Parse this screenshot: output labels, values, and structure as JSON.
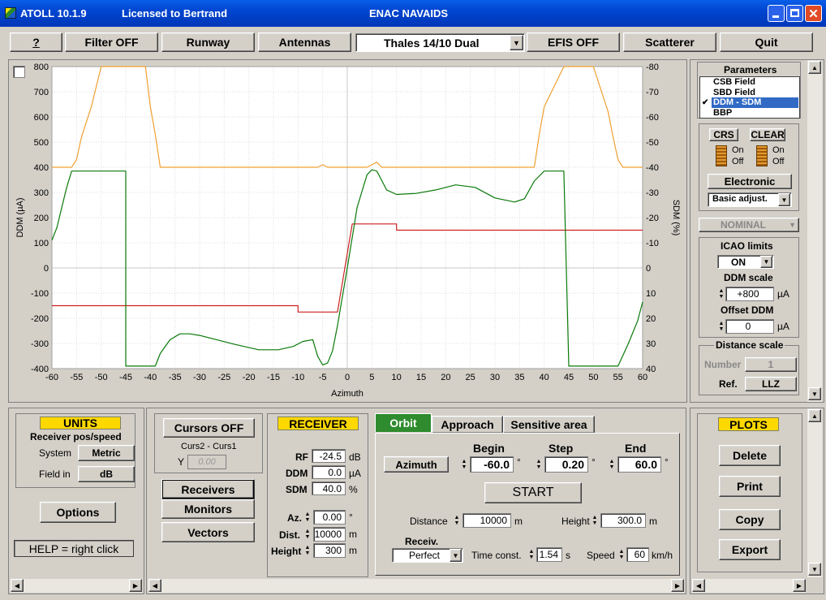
{
  "titlebar": {
    "app": "ATOLL 10.1.9",
    "license": "Licensed to Bertrand",
    "center": "ENAC NAVAIDS"
  },
  "toolbar": {
    "help": "?",
    "filter": "Filter OFF",
    "runway": "Runway",
    "antennas": "Antennas",
    "system": "Thales 14/10 Dual",
    "efis": "EFIS OFF",
    "scatterer": "Scatterer",
    "quit": "Quit"
  },
  "chart_data": {
    "type": "line",
    "xlabel": "Azimuth",
    "ylabel": "DDM (µA)",
    "y2label": "SDM (%)",
    "xlim": [
      -60,
      60
    ],
    "ylim": [
      -400,
      800
    ],
    "y2lim": [
      -40,
      -80
    ],
    "xticks": [
      "-60",
      "-55",
      "-50",
      "-45",
      "-40",
      "-35",
      "-30",
      "-25",
      "-20",
      "-15",
      "-10",
      "-5",
      "0",
      "5",
      "10",
      "15",
      "20",
      "25",
      "30",
      "35",
      "40",
      "45",
      "50",
      "55",
      "60"
    ],
    "yticks": [
      "800",
      "700",
      "600",
      "500",
      "400",
      "300",
      "200",
      "100",
      "0",
      "-100",
      "-200",
      "-300",
      "-400"
    ],
    "y2ticks": [
      "-80",
      "-70",
      "-60",
      "-50",
      "-40",
      "-30",
      "-20",
      "-10",
      "0",
      "10",
      "20",
      "30",
      "40"
    ],
    "colors": {
      "ddm": "#0a7a0a",
      "sdm": "#f0a030",
      "icao": "#cc2020",
      "ref": "#33d6d6"
    },
    "series": [
      {
        "name": "DDM - SDM",
        "x": [
          -60,
          -59,
          -58,
          -57,
          -56,
          -45,
          -45,
          -39,
          -38,
          -36,
          -34,
          -32,
          -30,
          -27,
          -23,
          -18,
          -14,
          -11,
          -9,
          -7,
          -6,
          -5,
          -4,
          -3,
          -2,
          0,
          2,
          4,
          5,
          6,
          8,
          10,
          14,
          18,
          22,
          26,
          30,
          34,
          36,
          38,
          40,
          44,
          45,
          55,
          57,
          59,
          60
        ],
        "y": [
          110,
          160,
          240,
          320,
          385,
          385,
          -390,
          -390,
          -340,
          -285,
          -262,
          -262,
          -268,
          -283,
          -303,
          -325,
          -325,
          -312,
          -292,
          -285,
          -352,
          -385,
          -378,
          -330,
          -230,
          0,
          240,
          370,
          390,
          385,
          310,
          292,
          296,
          310,
          330,
          320,
          278,
          262,
          275,
          345,
          385,
          385,
          -390,
          -390,
          -305,
          -210,
          -135
        ]
      },
      {
        "name": "SDM",
        "x": [
          -60,
          -57,
          -56,
          -55,
          -54,
          -52,
          -50,
          -45,
          -44,
          -44,
          -41,
          -40,
          -39,
          -38,
          -20,
          -10,
          -6,
          -5,
          -4,
          0,
          4,
          5,
          6,
          7,
          10,
          30,
          38,
          39,
          40,
          44,
          44,
          45,
          48,
          50,
          53,
          54,
          55,
          56,
          57,
          60
        ],
        "y": [
          400,
          400,
          400,
          430,
          520,
          640,
          800,
          800,
          800,
          800,
          800,
          640,
          530,
          400,
          400,
          400,
          400,
          410,
          400,
          400,
          400,
          410,
          420,
          400,
          400,
          400,
          400,
          530,
          640,
          800,
          800,
          800,
          800,
          800,
          620,
          520,
          430,
          400,
          400,
          400
        ]
      },
      {
        "name": "ICAO limits",
        "x": [
          -60,
          -10,
          -10,
          -2,
          1,
          1,
          10,
          10,
          60
        ],
        "y": [
          -150,
          -150,
          -175,
          -175,
          175,
          175,
          175,
          150,
          150
        ]
      }
    ]
  },
  "params": {
    "title": "Parameters",
    "items": [
      "CSB Field",
      "SBD Field",
      "DDM - SDM",
      "BBP"
    ],
    "selected": "DDM - SDM",
    "check": "✔"
  },
  "crs": {
    "label": "CRS",
    "on": "On",
    "off": "Off"
  },
  "clear": {
    "label": "CLEAR",
    "on": "On",
    "off": "Off"
  },
  "electronic": "Electronic",
  "basic_adjust": "Basic adjust.",
  "nominal": "NOMINAL",
  "icao": {
    "title": "ICAO limits",
    "value": "ON"
  },
  "ddm_scale": {
    "title": "DDM scale",
    "value": "+800",
    "unit": "µA"
  },
  "offset_ddm": {
    "title": "Offset DDM",
    "value": "0",
    "unit": "µA"
  },
  "distance_scale": {
    "title": "Distance scale",
    "number_label": "Number",
    "number": "1",
    "ref_label": "Ref.",
    "ref": "LLZ"
  },
  "units": {
    "title": "UNITS",
    "subtitle": "Receiver pos/speed",
    "system_label": "System",
    "system": "Metric",
    "field_label": "Field in",
    "field": "dB"
  },
  "options": "Options",
  "help_text": "HELP = right click",
  "cursors": {
    "button": "Cursors OFF",
    "label": "Curs2 - Curs1",
    "y_label": "Y",
    "y_value": "0.00"
  },
  "nav": {
    "receivers": "Receivers",
    "monitors": "Monitors",
    "vectors": "Vectors"
  },
  "receiver": {
    "title": "RECEIVER",
    "rf_label": "RF",
    "rf": "-24.5",
    "rf_unit": "dB",
    "ddm_label": "DDM",
    "ddm": "0.0",
    "ddm_unit": "µA",
    "sdm_label": "SDM",
    "sdm": "40.0",
    "sdm_unit": "%",
    "az_label": "Az.",
    "az": "0.00",
    "az_unit": "°",
    "dist_label": "Dist.",
    "dist": "10000",
    "dist_unit": "m",
    "height_label": "Height",
    "height": "300",
    "height_unit": "m"
  },
  "tabs": [
    "Orbit",
    "Approach",
    "Sensitive area"
  ],
  "orbit": {
    "azimuth": "Azimuth",
    "begin_label": "Begin",
    "begin": "-60.0",
    "step_label": "Step",
    "step": "0.20",
    "end_label": "End",
    "end": "60.0",
    "deg": "°",
    "start": "START",
    "distance_label": "Distance",
    "distance": "10000",
    "distance_unit": "m",
    "height_label": "Height",
    "height": "300.0",
    "height_unit": "m",
    "receiv_label": "Receiv.",
    "receiv": "Perfect",
    "timeconst_label": "Time const.",
    "timeconst": "1.54",
    "timeconst_unit": "s",
    "speed_label": "Speed",
    "speed": "60",
    "speed_unit": "km/h"
  },
  "plots": {
    "title": "PLOTS",
    "delete": "Delete",
    "print": "Print",
    "copy": "Copy",
    "export": "Export"
  }
}
